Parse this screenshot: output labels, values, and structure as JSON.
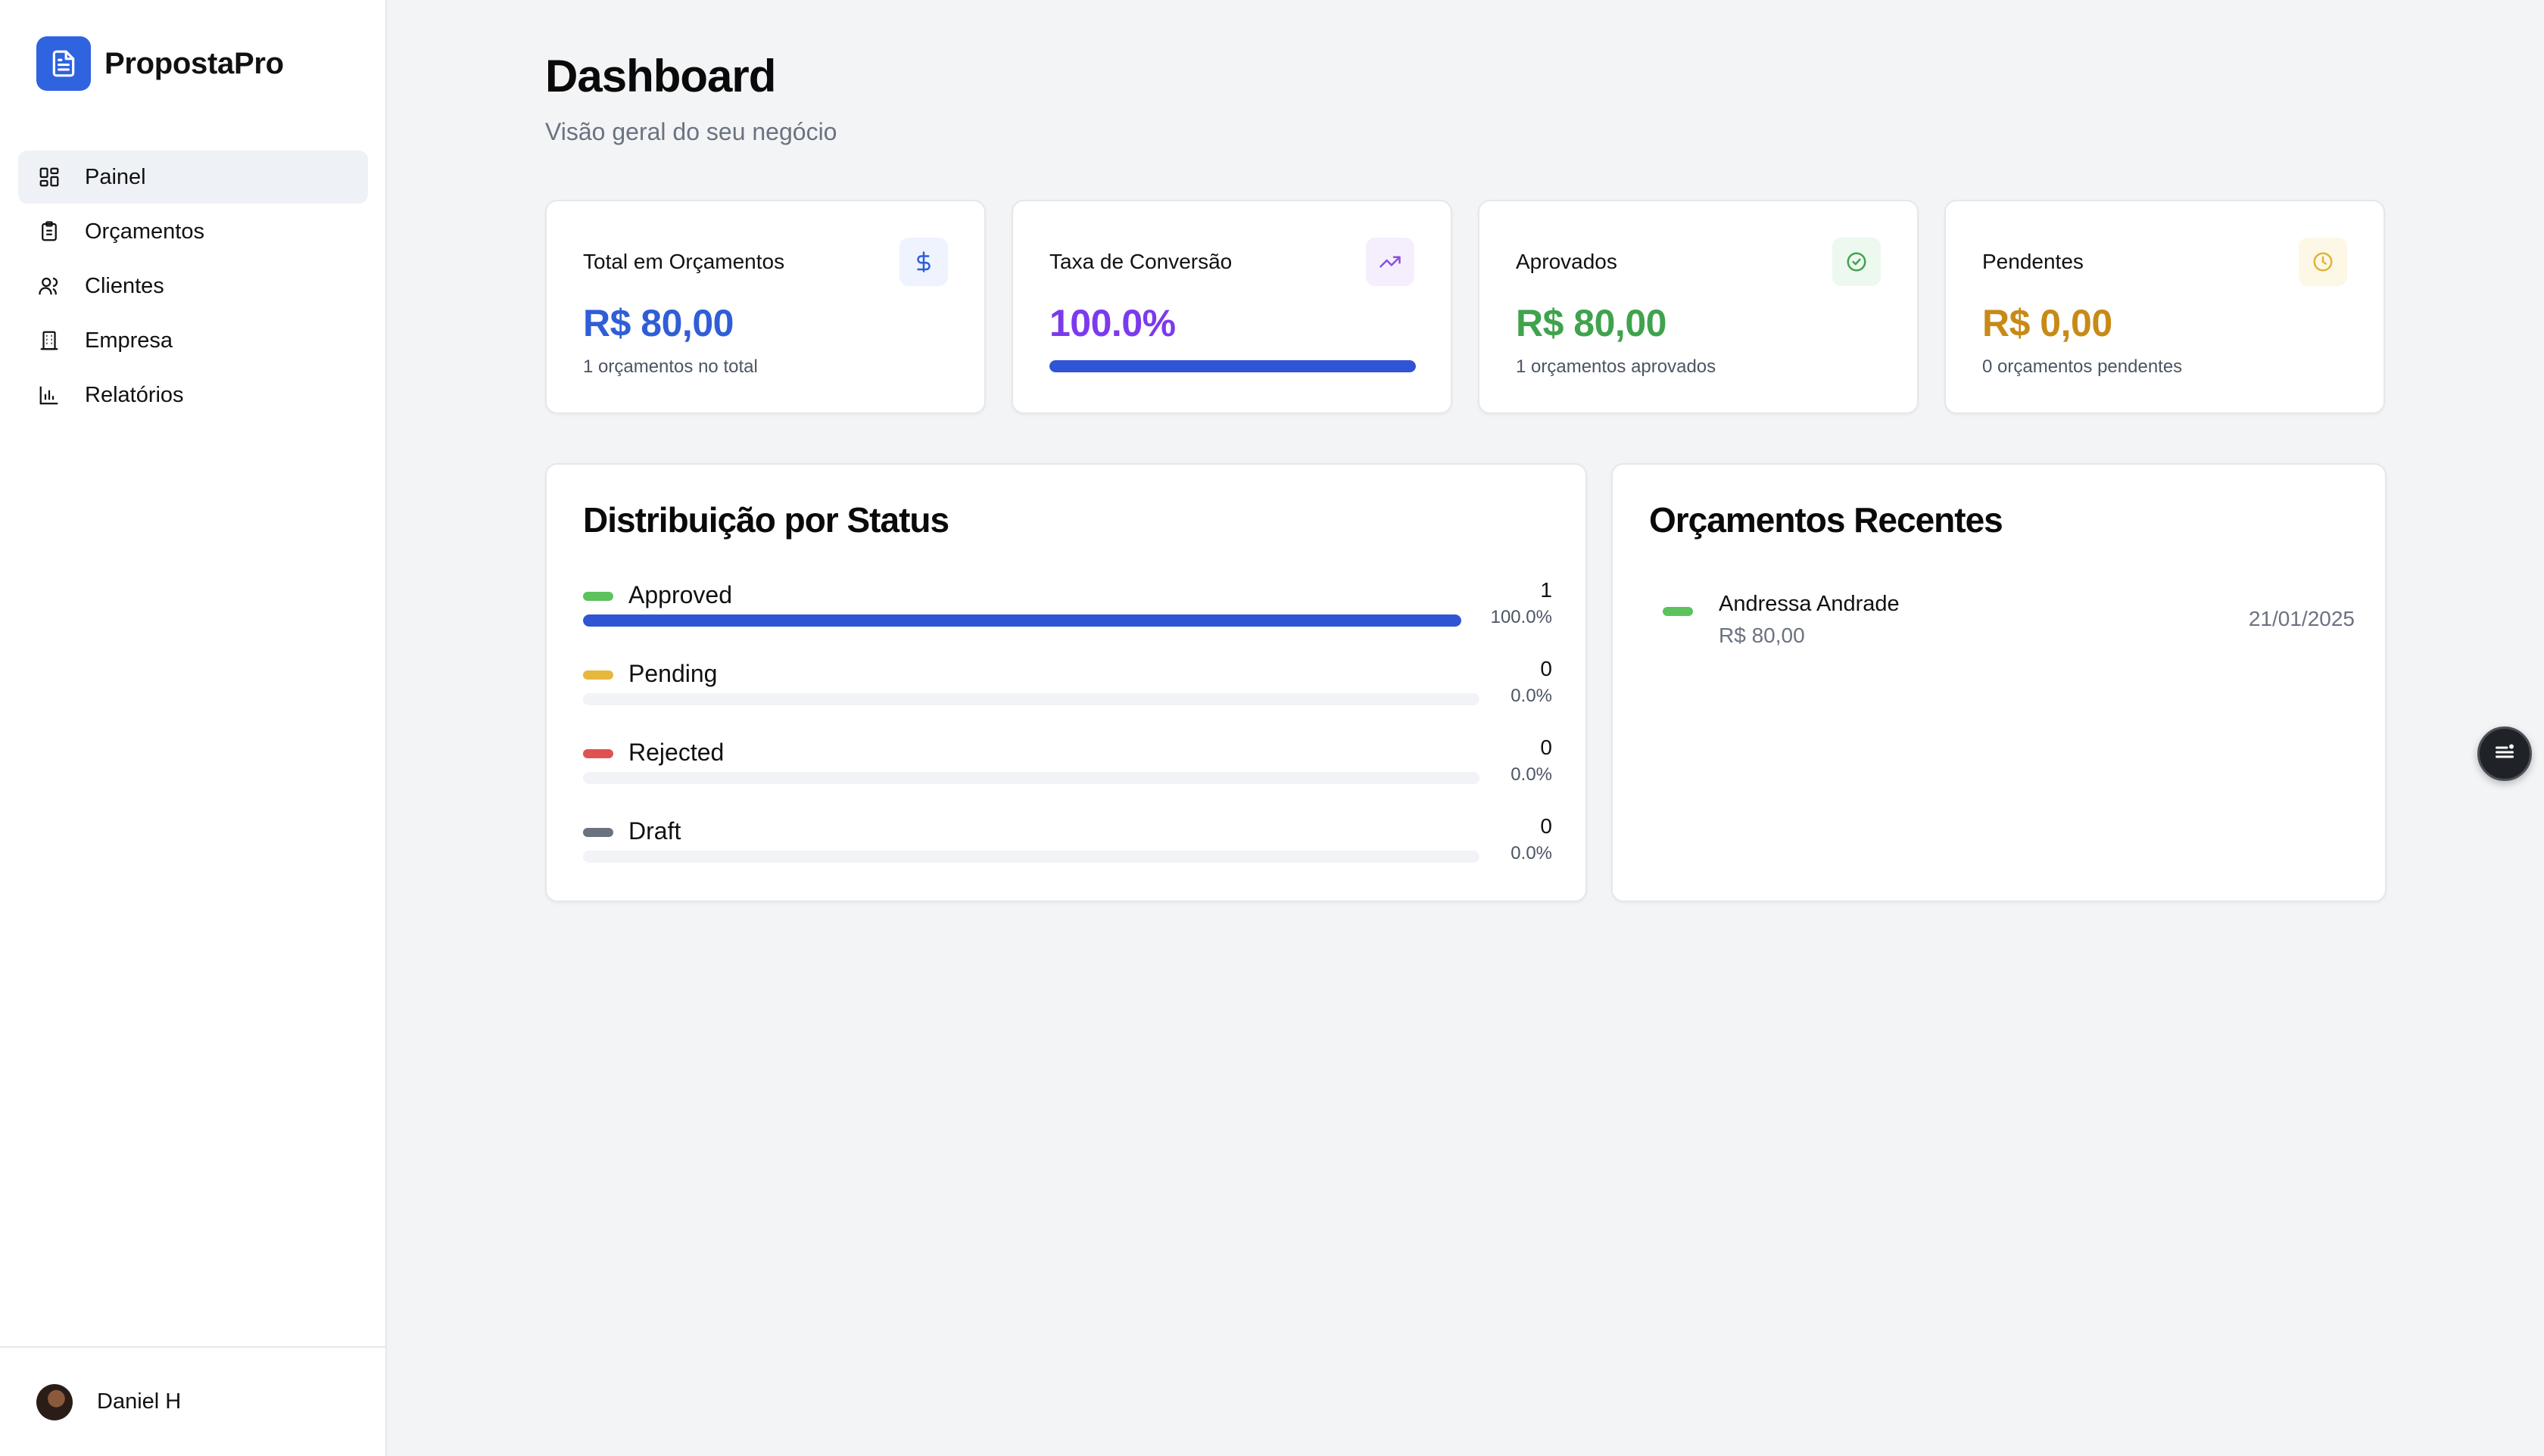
{
  "app": {
    "name": "PropostaPro"
  },
  "nav": {
    "items": [
      {
        "label": "Painel",
        "icon": "dashboard-icon",
        "active": true
      },
      {
        "label": "Orçamentos",
        "icon": "clipboard-icon",
        "active": false
      },
      {
        "label": "Clientes",
        "icon": "users-icon",
        "active": false
      },
      {
        "label": "Empresa",
        "icon": "building-icon",
        "active": false
      },
      {
        "label": "Relatórios",
        "icon": "bar-chart-icon",
        "active": false
      }
    ]
  },
  "user": {
    "name": "Daniel H"
  },
  "header": {
    "title": "Dashboard",
    "subtitle": "Visão geral do seu negócio"
  },
  "stats": {
    "total": {
      "title": "Total em Orçamentos",
      "value": "R$ 80,00",
      "note": "1 orçamentos no total",
      "color": "#2f5ed8",
      "icon": "dollar-icon"
    },
    "conversion": {
      "title": "Taxa de Conversão",
      "value": "100.0%",
      "progress": 1.0,
      "color": "#7c3aed",
      "icon": "trending-up-icon"
    },
    "approved": {
      "title": "Aprovados",
      "value": "R$ 80,00",
      "note": "1 orçamentos aprovados",
      "color": "#3fa34d",
      "icon": "check-circle-icon"
    },
    "pending": {
      "title": "Pendentes",
      "value": "R$ 0,00",
      "note": "0 orçamentos pendentes",
      "color": "#c88a17",
      "icon": "clock-icon"
    }
  },
  "distribution": {
    "title": "Distribuição por Status",
    "rows": [
      {
        "label": "Approved",
        "count": "1",
        "percent": "100.0%",
        "fraction": 1.0,
        "color": "#5cc25e"
      },
      {
        "label": "Pending",
        "count": "0",
        "percent": "0.0%",
        "fraction": 0.0,
        "color": "#e6b83d"
      },
      {
        "label": "Rejected",
        "count": "0",
        "percent": "0.0%",
        "fraction": 0.0,
        "color": "#e05252"
      },
      {
        "label": "Draft",
        "count": "0",
        "percent": "0.0%",
        "fraction": 0.0,
        "color": "#6b7280"
      }
    ]
  },
  "recent": {
    "title": "Orçamentos Recentes",
    "items": [
      {
        "name": "Andressa Andrade",
        "amount": "R$ 80,00",
        "date": "21/01/2025",
        "color": "#5cc25e"
      }
    ]
  },
  "fab": {
    "icon": "menu-icon"
  }
}
